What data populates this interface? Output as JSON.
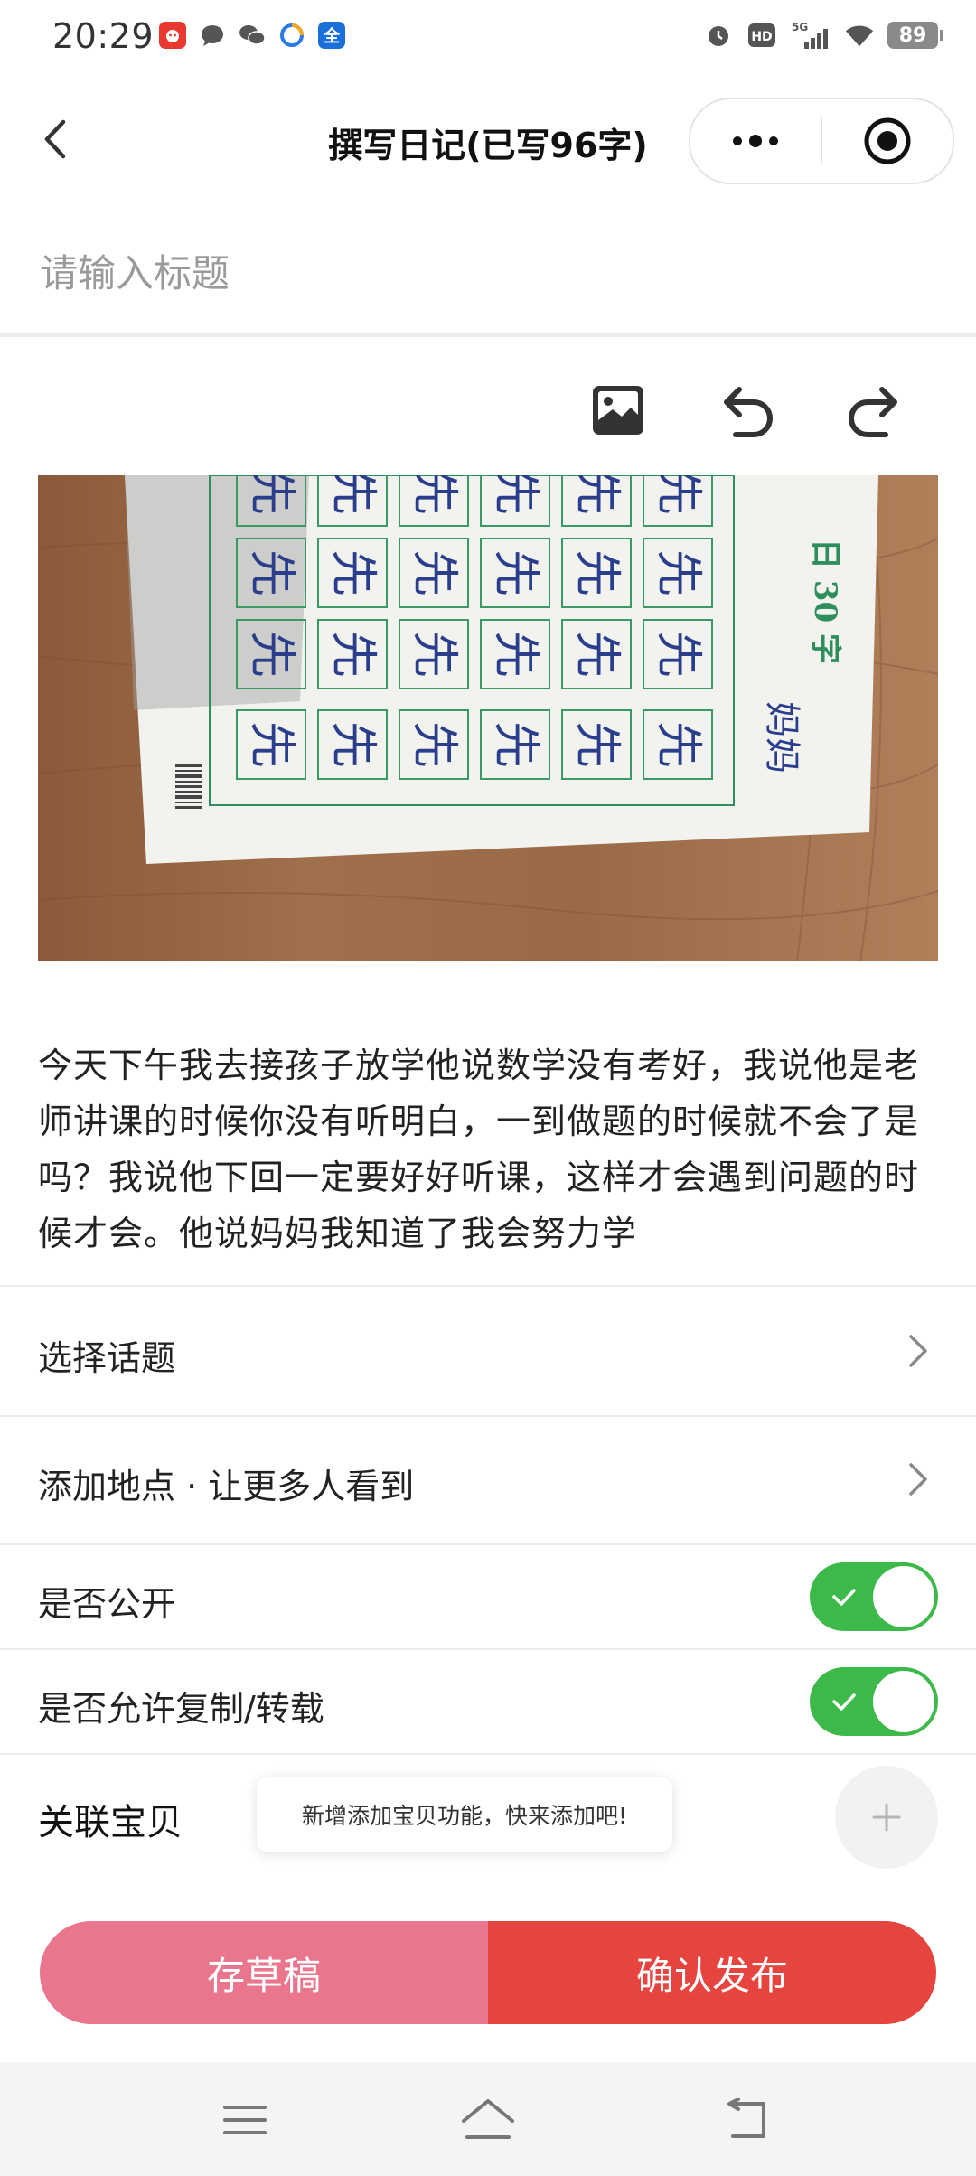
{
  "status_bar": {
    "time": "20:29",
    "battery": "89",
    "network": "5G",
    "hd_label": "HD",
    "app_icons": [
      "app-red-icon",
      "message-icon",
      "wechat-icon",
      "browser-icon",
      "quan-app-icon"
    ],
    "quan_label": "全"
  },
  "nav": {
    "title": "撰写日记(已写96字)"
  },
  "title_field": {
    "placeholder": "请输入标题",
    "value": ""
  },
  "toolbar": {
    "icons": [
      "image-icon",
      "undo-icon",
      "redo-icon"
    ]
  },
  "photo": {
    "header_text": "日 30 字",
    "name_text": "妈妈",
    "character": "先"
  },
  "diary": {
    "text": " 今天下午我去接孩子放学他说数学没有考好，我说他是老师讲课的时候你没有听明白，一到做题的时候就不会了是吗？我说他下回一定要好好听课，这样才会遇到问题的时候才会。他说妈妈我知道了我会努力学"
  },
  "options": {
    "topic_label": "选择话题",
    "location_label": "添加地点 · 让更多人看到",
    "public_label": "是否公开",
    "public_on": true,
    "copy_label": "是否允许复制/转载",
    "copy_on": true,
    "baby_label": "关联宝贝",
    "baby_tip": "新增添加宝贝功能，快来添加吧!"
  },
  "actions": {
    "draft_label": "存草稿",
    "publish_label": "确认发布"
  },
  "colors": {
    "toggle_on": "#3db94a",
    "draft": "#e9768c",
    "publish": "#e5443f"
  }
}
